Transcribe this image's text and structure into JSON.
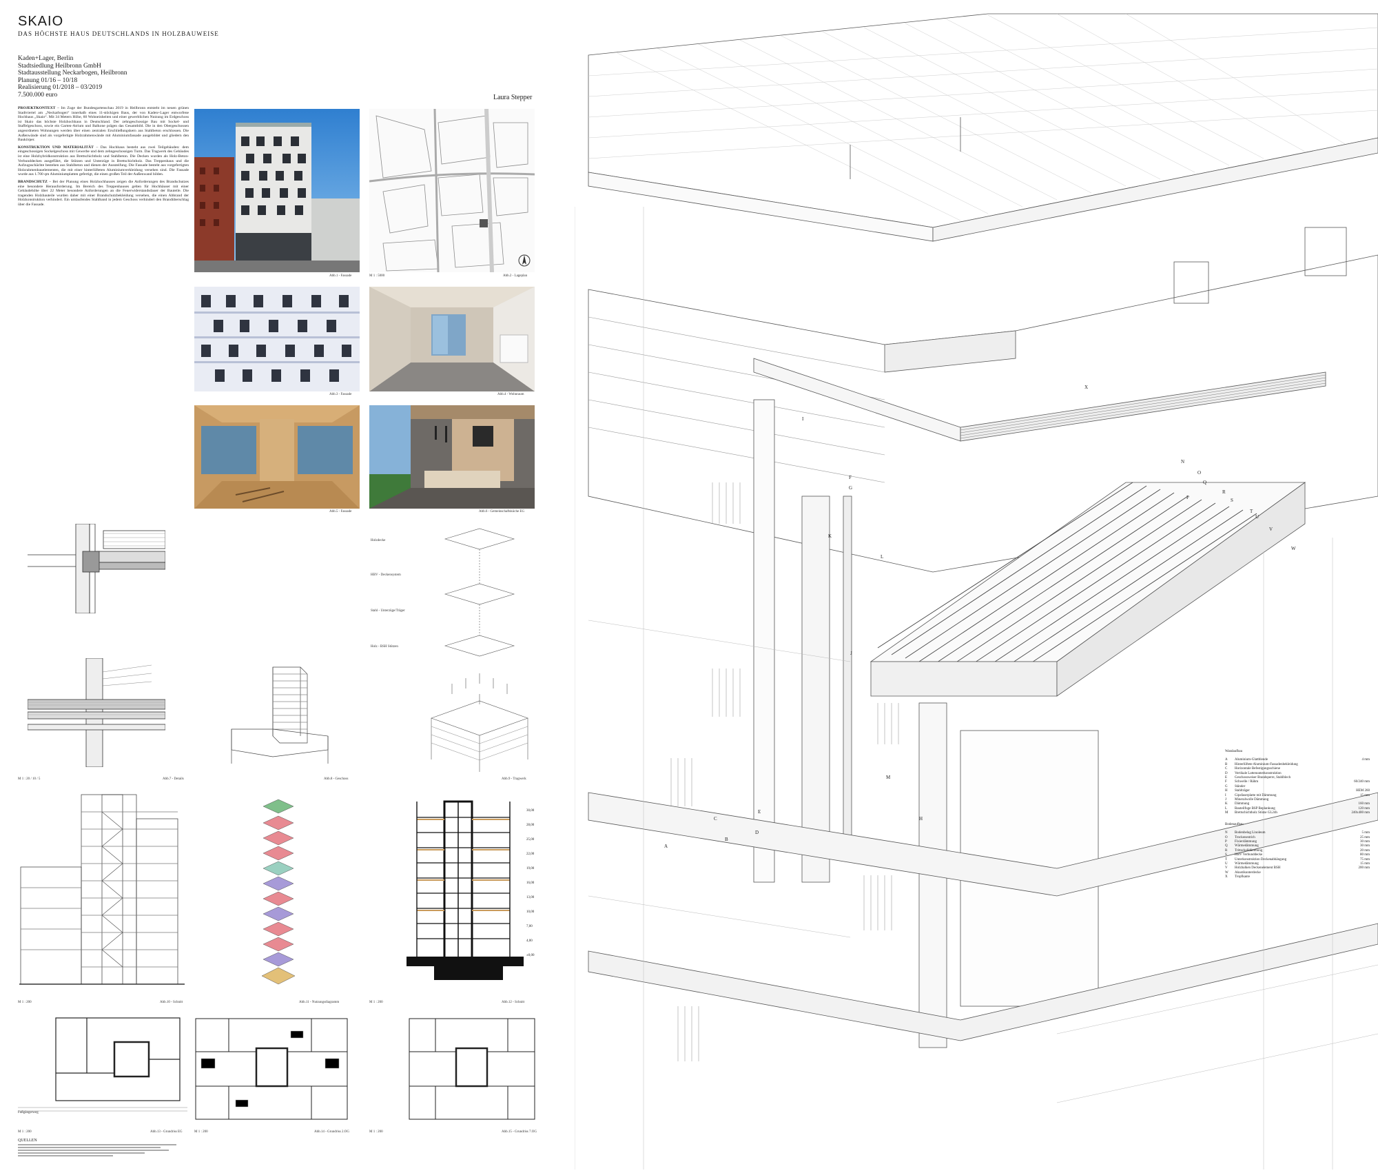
{
  "sheet": {
    "title": "SKAIO",
    "subtitle": "DAS HÖCHSTE HAUS DEUTSCHLANDS IN HOLZBAUWEISE",
    "meta": [
      "Kaden+Lager, Berlin",
      "Stadtsiedlung Heilbronn GmbH",
      "Stadtausstellung Neckarbogen, Heilbronn",
      "Planung  01/16 – 10/18",
      "Realisierung  01/2018 – 03/2019",
      "7.500.000 euro"
    ],
    "author": "Laura Stepper",
    "sections": [
      {
        "heading": "PROJEKTKONTEXT",
        "text": "– Im Zuge der Bundesgartenschau 2019 in Heilbronn entsteht im neuen grünen Stadtviertel am „Neckarbogen“ innerhalb eines 11-stöckigen Baus, der von Kaden+Lager entworfene Hochhaus „Skaio“. Mit 34 Metern Höhe, 60 Wohneinheiten und einer gewerblichen Nutzung im Erdgeschoss ist Skaio das höchste Holzhochhaus in Deutschland. Der zehngeschossige Bau mit Sockel- und Staffelgeschoss, sowie ein Garten-Atrium und Balkone prägen das Gesamtbild. Die in den Obergeschossen angeordneten Wohnungen werden über einen zentralen Erschließungskern aus Stahlbeton erschlossen. Die Außenwände sind als vorgefertigte Holzrahmenwände mit Aluminiumfassade ausgebildet und gliedern den Baukörper."
      },
      {
        "heading": "KONSTRUKTION UND MATERIALITÄT",
        "text": "– Das Hochhaus besteht aus zwei Teilgebäuden: dem eingeschossigen Sockelgeschoss mit Gewerbe und dem zehngeschossigen Turm. Das Tragwerk des Gebäudes ist eine Holzhybridkonstruktion aus Brettschichtholz und Stahlbeton. Die Decken wurden als Holz-Beton-Verbunddecken ausgeführt, die Stützen und Unterzüge in Brettschichtholz. Das Treppenhaus und die Aufzugsschächte bestehen aus Stahlbeton und dienen der Aussteifung. Die Fassade besteht aus vorgefertigten Holzrahmenbauelementen, die mit einer hinterlüfteten Aluminiumverkleidung versehen sind. Die Fassade wurde aus 1.700 qm Aluminiumplatten gefertigt, die einen großen Teil der Außenwand bilden."
      },
      {
        "heading": "BRANDSCHUTZ",
        "text": "– Bei der Planung eines Holzhochhauses zeigen die Anforderungen des Brandschutzes eine besondere Herausforderung. Im Bereich des Treppenhauses gelten für Hochhäuser mit einer Gebäudehöhe über 22 Meter besondere Anforderungen an die Feuerwiderstandsdauer der Bauteile. Die tragenden Holzbauteile wurden daher mit einer Brandschutzbekleidung versehen, die einen Abbrand der Holzkonstruktion verhindert. Ein umlaufendes Stahlband in jedem Geschoss verhindert den Brandüberschlag über die Fassade."
      }
    ],
    "captions": {
      "fig1": "Abb.1 - Fassade",
      "fig2": "Abb.2 - Lageplan",
      "fig2_scale": "M 1 : 5000",
      "fig3": "Abb.3 - Fassade",
      "fig4": "Abb.4 - Wohnraum",
      "fig5": "Abb.5 - Fassade",
      "fig6": "Abb.6 - Gemeinschaftsküche EG",
      "fig7_scale": "M 1 : 20 / 10 / 5",
      "fig7": "Abb.7 - Details",
      "fig8": "Abb.8 - Geschoss",
      "fig9": "Abb.9 - Tragwerk",
      "fig10_scale": "M 1 : 200",
      "fig10": "Abb.10 - Schnitt",
      "fig11": "Abb.11 - Nutzungsdiagramm",
      "fig12_scale": "M 1 : 200",
      "fig12": "Abb.12 - Schnitt",
      "fig13_scale": "M 1 : 200",
      "fig13": "Abb.13 - Grundriss EG",
      "fig14_scale": "M 1 : 200",
      "fig14": "Abb.14 - Grundriss 2.OG",
      "fig15_scale": "M 1 : 200",
      "fig15": "Abb.15 - Grundriss 7.OG",
      "fussgaenger": "Fußgängerweg"
    },
    "explode_labels": [
      "Holzdecke",
      "HBV - Deckensystem",
      "Stahl - Unterzüge/Träger",
      "Holz - BSH Stützen"
    ],
    "section_levels": [
      "30,00",
      "28,00",
      "25,00",
      "22,00",
      "19,00",
      "16,00",
      "13,00",
      "10,00",
      "7,00",
      "4,00",
      "±0,00"
    ],
    "quellen_heading": "QUELLEN"
  },
  "legend": {
    "wall_heading": "Wandaufbau",
    "wall_items": [
      {
        "k": "A",
        "t": "Aluminium-Glattblende",
        "v": "4  mm"
      },
      {
        "k": "B",
        "t": "Hinterlüftete Aluminium-Fassadenbekleidung",
        "v": ""
      },
      {
        "k": "C",
        "t": "Horizontale Befestigungsschiene",
        "v": ""
      },
      {
        "k": "D",
        "t": "Vertikale Lattenunterkonstruktion",
        "v": ""
      },
      {
        "k": "E",
        "t": "Geschossweiser Brandsperre, Stahlblech",
        "v": ""
      },
      {
        "k": "F",
        "t": "Schwelle / Rähm",
        "v": "60/240 mm"
      },
      {
        "k": "G",
        "t": "Ständer",
        "v": ""
      },
      {
        "k": "H",
        "t": "Stahlträger",
        "v": "HEM 260"
      },
      {
        "k": "I",
        "t": "Gipsfaserplatte mit Dämmung",
        "v": "15 mm"
      },
      {
        "k": "J",
        "t": "Mineralwolle Dämmung",
        "v": ""
      },
      {
        "k": "K",
        "t": "Dämmung",
        "v": "160 mm"
      },
      {
        "k": "L",
        "t": "Bauteilfuge BSP Beplankung",
        "v": "120 mm"
      },
      {
        "k": "M",
        "t": "Brettschichtholz Stütze GL24h",
        "v": "240x400 mm"
      }
    ],
    "floor_heading": "Bodenaufbau",
    "floor_items": [
      {
        "k": "N",
        "t": "Bodenbelag Linoleum",
        "v": "5  mm"
      },
      {
        "k": "O",
        "t": "Trockenestrich",
        "v": "25  mm"
      },
      {
        "k": "P",
        "t": "Fixierdämmung",
        "v": "30  mm"
      },
      {
        "k": "Q",
        "t": "Wärmedämmung",
        "v": "30  mm"
      },
      {
        "k": "R",
        "t": "Trittschalldämmung",
        "v": "20  mm"
      },
      {
        "k": "S",
        "t": "HBV Verbunddecke",
        "v": "80  mm"
      },
      {
        "k": "T",
        "t": "Unterkonstruktion Deckenabhängung",
        "v": "75  mm"
      },
      {
        "k": "U",
        "t": "Wärmedämmung",
        "v": "15  mm"
      },
      {
        "k": "V",
        "t": "Holzbalken Deckenelement BSH",
        "v": "200  mm"
      },
      {
        "k": "W",
        "t": "Akustikunterdecke",
        "v": ""
      },
      {
        "k": "X",
        "t": "Tropfkante",
        "v": ""
      }
    ]
  },
  "detail_labels": [
    "A",
    "B",
    "C",
    "D",
    "E",
    "F",
    "G",
    "H",
    "I",
    "J",
    "K",
    "L",
    "M",
    "N",
    "O",
    "P",
    "Q",
    "R",
    "S",
    "T",
    "U",
    "V",
    "W",
    "X"
  ]
}
